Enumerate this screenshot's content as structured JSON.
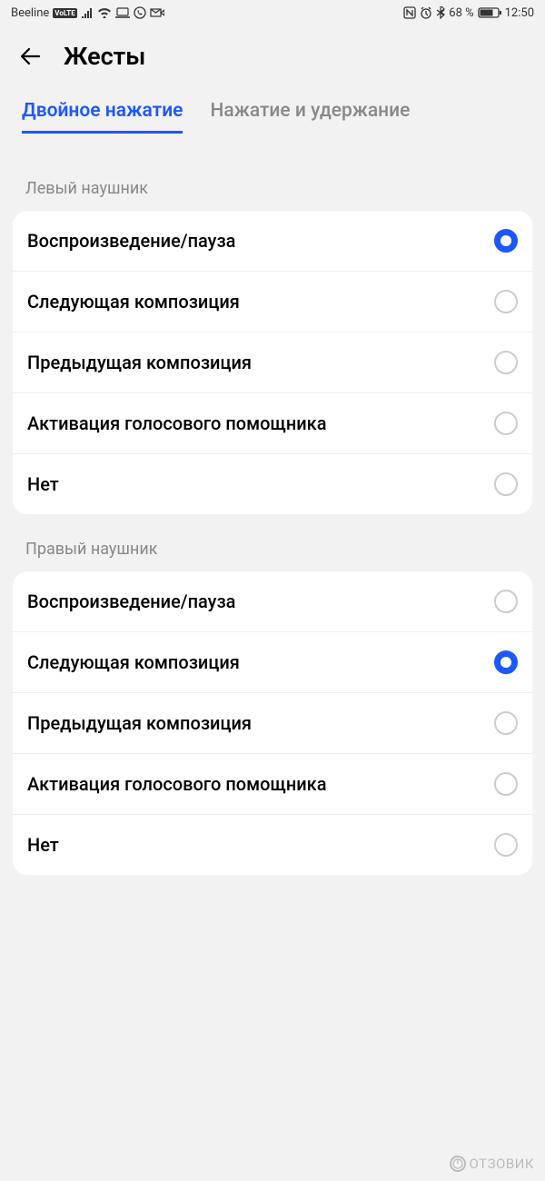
{
  "statusbar": {
    "carrier": "Beeline",
    "volte": "VoLTE",
    "battery": "68 %",
    "time": "12:50"
  },
  "header": {
    "title": "Жесты"
  },
  "tabs": [
    {
      "label": "Двойное нажатие",
      "active": true
    },
    {
      "label": "Нажатие и удержание",
      "active": false
    }
  ],
  "sections": {
    "left": {
      "title": "Левый наушник",
      "options": [
        {
          "label": "Воспроизведение/пауза",
          "selected": true
        },
        {
          "label": "Следующая композиция",
          "selected": false
        },
        {
          "label": "Предыдущая композиция",
          "selected": false
        },
        {
          "label": "Активация голосового помощника",
          "selected": false
        },
        {
          "label": "Нет",
          "selected": false
        }
      ]
    },
    "right": {
      "title": "Правый наушник",
      "options": [
        {
          "label": "Воспроизведение/пауза",
          "selected": false
        },
        {
          "label": "Следующая композиция",
          "selected": true
        },
        {
          "label": "Предыдущая композиция",
          "selected": false
        },
        {
          "label": "Активация голосового помощника",
          "selected": false
        },
        {
          "label": "Нет",
          "selected": false
        }
      ]
    }
  },
  "watermark": "ОТЗОВИК"
}
